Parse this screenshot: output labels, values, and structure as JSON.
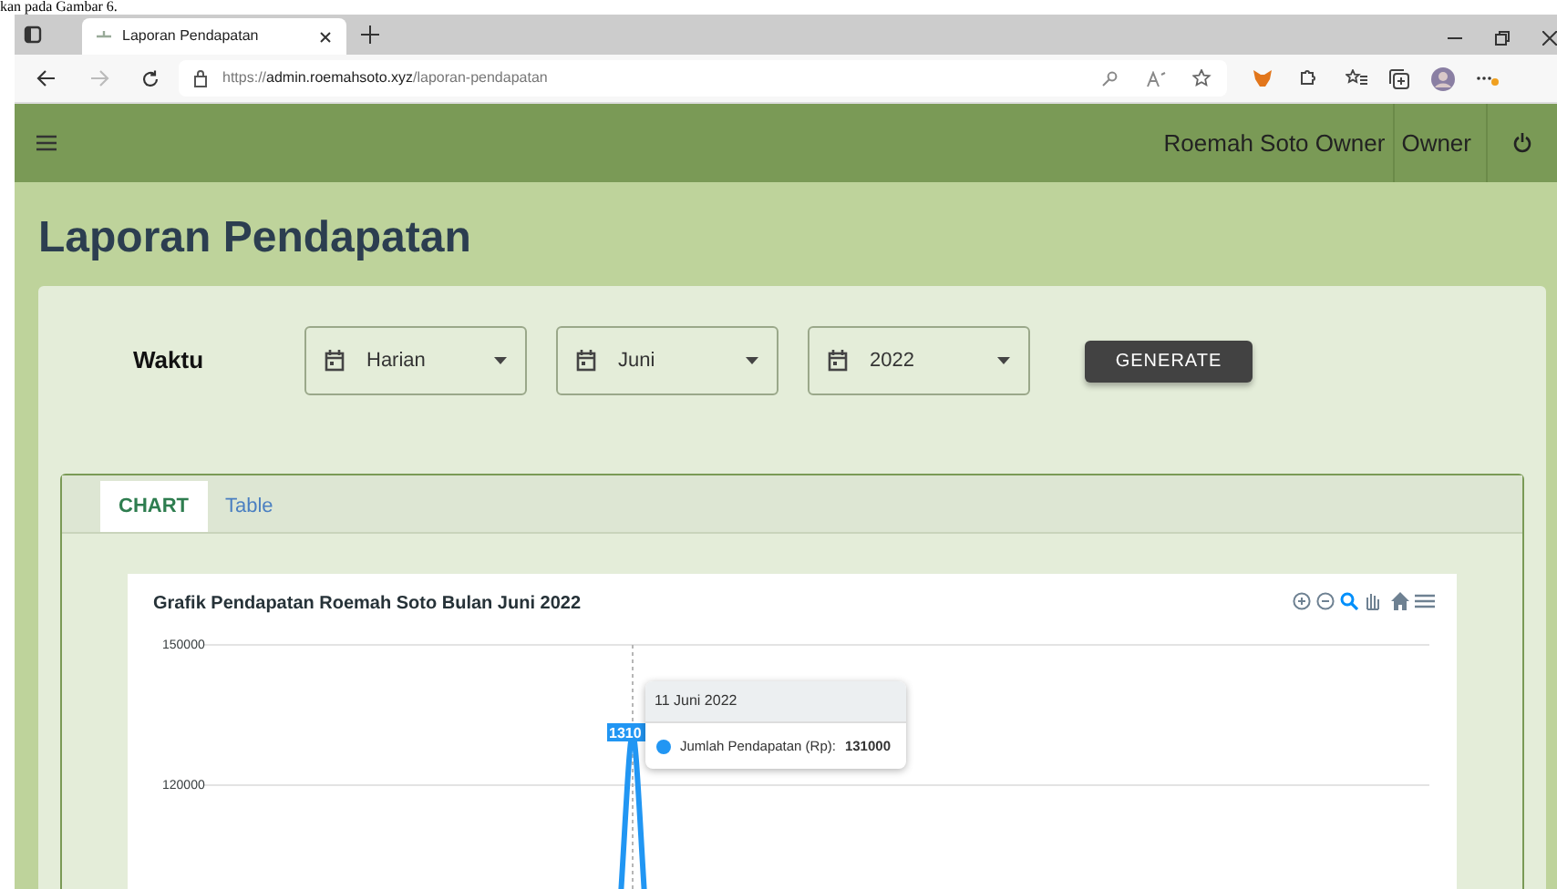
{
  "document_caption": "kan pada Gambar 6.",
  "browser": {
    "tab_title": "Laporan Pendapatan",
    "url": {
      "scheme": "https://",
      "host": "admin.roemahsoto.xyz",
      "path": "/laporan-pendapatan"
    }
  },
  "navbar": {
    "user_name": "Roemah Soto Owner",
    "role": "Owner"
  },
  "page_title": "Laporan Pendapatan",
  "filter": {
    "label": "Waktu",
    "selects": [
      {
        "value": "Harian"
      },
      {
        "value": "Juni"
      },
      {
        "value": "2022"
      }
    ],
    "button": "GENERATE"
  },
  "tabs": [
    {
      "label": "CHART",
      "selected": true
    },
    {
      "label": "Table",
      "selected": false
    }
  ],
  "chart": {
    "title": "Grafik Pendapatan Roemah Soto Bulan Juni 2022",
    "y_tick_labels": [
      "150000",
      "120000"
    ],
    "data_label": "1310",
    "tooltip": {
      "title": "11 Juni 2022",
      "label": "Jumlah Pendapatan (Rp):",
      "value": "131000"
    }
  }
}
